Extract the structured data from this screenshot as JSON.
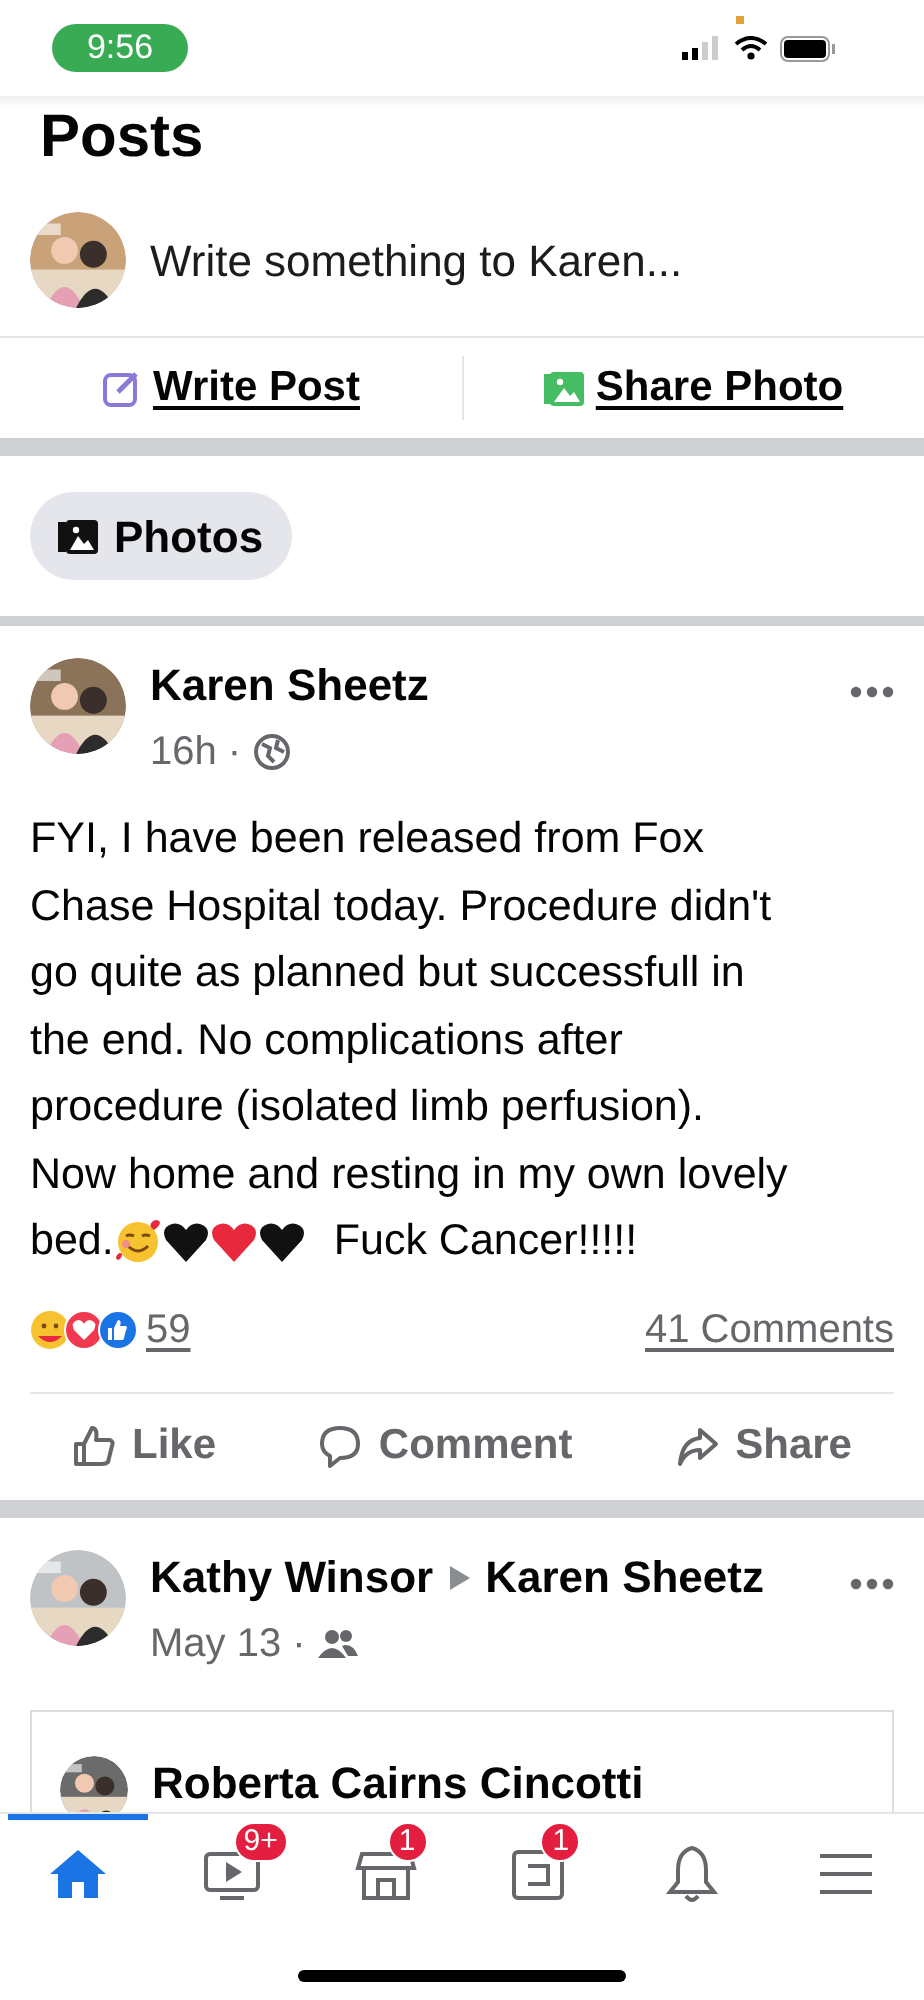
{
  "status_bar": {
    "time": "9:56"
  },
  "header": {
    "title": "Posts"
  },
  "composer": {
    "placeholder": "Write something to Karen..."
  },
  "composer_actions": [
    {
      "kind": "write",
      "label": "Write Post"
    },
    {
      "label": "Share Photo"
    }
  ],
  "photos_chip": {
    "label": "Photos"
  },
  "posts": [
    {
      "kind": "public",
      "author": "Karen Sheetz",
      "time": "16h ·",
      "body_lines": [
        "FYI, I have been released from Fox",
        "Chase Hospital today. Procedure didn't",
        "go quite as planned but successfull in",
        "the end. No complications after",
        "procedure (isolated limb perfusion).",
        "Now home and resting in my own lovely",
        "bed."
      ],
      "hearts": [
        {
          "color": "#111111"
        },
        {
          "color": "#e8283c"
        },
        {
          "color": "#111111"
        }
      ],
      "body_end": "Fuck Cancer!!!!!",
      "reactions": "59",
      "comments": "41 Comments",
      "actions": [
        {
          "kind": "like",
          "label": "Like"
        },
        {
          "kind": "comment",
          "label": "Comment"
        },
        {
          "kind": "share",
          "label": "Share"
        }
      ]
    },
    {
      "kind": "friends",
      "author": "Kathy Winsor",
      "target": "Karen Sheetz",
      "time": "May 13 ·",
      "shared_author": "Roberta Cairns Cincotti"
    }
  ],
  "nav": [
    {
      "kind": "home",
      "selected": true
    },
    {
      "kind": "video",
      "selected": false,
      "badge": "9+"
    },
    {
      "kind": "market",
      "selected": false,
      "badge": "1"
    },
    {
      "kind": "pages",
      "selected": false,
      "badge": "1"
    },
    {
      "kind": "bell",
      "selected": false
    },
    {
      "kind": "menu",
      "selected": false
    }
  ]
}
